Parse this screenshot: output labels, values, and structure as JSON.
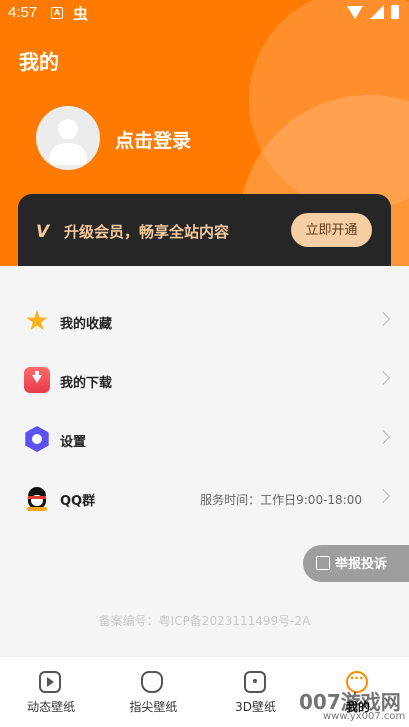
{
  "status_bar": {
    "time": "4:57",
    "icon_a": "A",
    "icon_b": "虫"
  },
  "header": {
    "title": "我的",
    "login_text": "点击登录"
  },
  "vip": {
    "logo": "V",
    "text": "升级会员，畅享全站内容",
    "button": "立即开通"
  },
  "menu": {
    "items": [
      {
        "label": "我的收藏",
        "icon": "star-icon"
      },
      {
        "label": "我的下载",
        "icon": "download-icon"
      },
      {
        "label": "设置",
        "icon": "settings-icon"
      },
      {
        "label": "QQ群",
        "icon": "qq-icon",
        "extra": "服务时间：工作日9:00-18:00"
      }
    ]
  },
  "report_button": "举报投诉",
  "icp": "备案编号：粤ICP备2023111499号-2A",
  "tabs": [
    {
      "label": "动态壁纸",
      "icon": "play-icon"
    },
    {
      "label": "指尖壁纸",
      "icon": "finger-icon"
    },
    {
      "label": "3D壁纸",
      "icon": "cube-icon"
    },
    {
      "label": "我的",
      "icon": "mine-icon",
      "active": true
    }
  ],
  "watermark": {
    "main": "007游戏网",
    "sub": "www.yx007.com"
  },
  "colors": {
    "brand_orange": "#ff7a00",
    "vip_gold": "#f3c89a",
    "vip_dark": "#262626"
  }
}
